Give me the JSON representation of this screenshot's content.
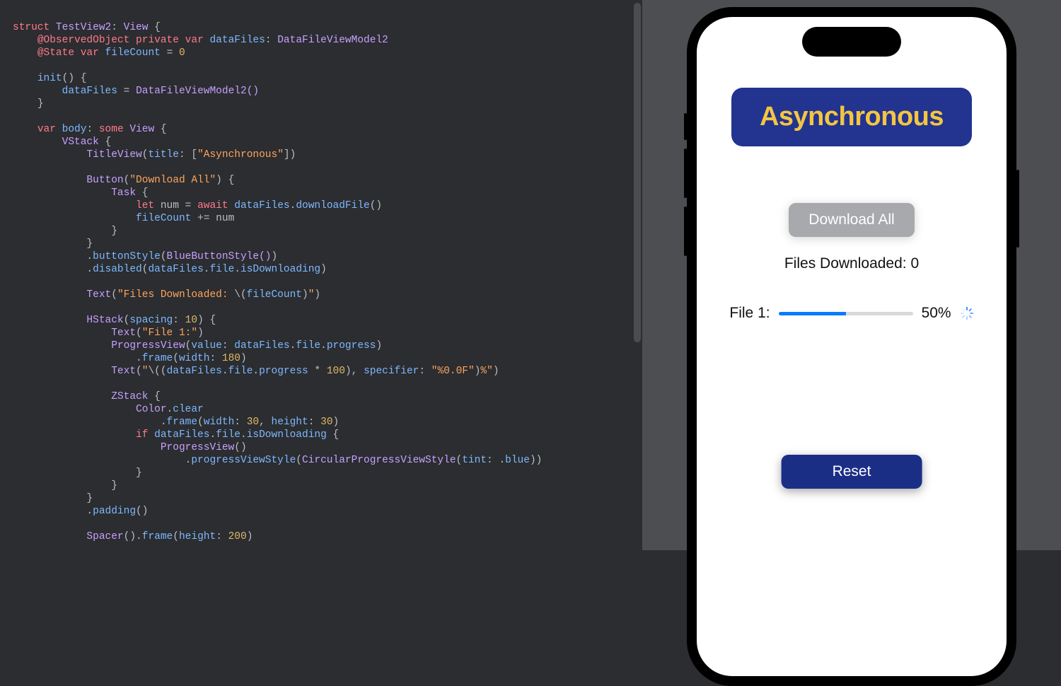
{
  "code": {
    "l1": {
      "kw": "struct",
      "name": "TestView2",
      "colon": ": ",
      "type": "View",
      "brace": " {"
    },
    "l2": {
      "attr": "@ObservedObject",
      "kw1": "private",
      "kw2": "var",
      "name": "dataFiles",
      "colon": ": ",
      "type": "DataFileViewModel2"
    },
    "l3": {
      "attr": "@State",
      "kw": "var",
      "name": "fileCount",
      "eq": " = ",
      "num": "0"
    },
    "l4": "",
    "l5": {
      "name": "init",
      "parens": "() {"
    },
    "l6": {
      "lhs": "dataFiles",
      "eq": " = ",
      "rhs": "DataFileViewModel2()"
    },
    "l7": "}",
    "l8": "",
    "l9": {
      "kw": "var",
      "name": "body",
      "colon": ": ",
      "some": "some",
      "type": "View",
      "brace": " {"
    },
    "l10": {
      "name": "VStack",
      "brace": " {"
    },
    "l11": {
      "name": "TitleView",
      "open": "(",
      "key": "title",
      "colon": ": [",
      "str": "\"Asynchronous\"",
      "close": "])"
    },
    "l12": "",
    "l13": {
      "name": "Button",
      "open": "(",
      "str": "\"Download All\"",
      "close": ") {"
    },
    "l14": {
      "name": "Task",
      "brace": " {"
    },
    "l15": {
      "kw1": "let",
      "name": "num",
      "eq": " = ",
      "kw2": "await",
      "call": "dataFiles",
      "dot": ".",
      "method": "downloadFile",
      "parens": "()"
    },
    "l16": {
      "lhs": "fileCount",
      "op": " += ",
      "rhs": "num"
    },
    "l17": "}",
    "l18": "}",
    "l19": {
      "dot": ".",
      "method": "buttonStyle",
      "open": "(",
      "arg": "BlueButtonStyle()",
      "close": ")"
    },
    "l20": {
      "dot": ".",
      "method": "disabled",
      "open": "(",
      "arg1": "dataFiles",
      "d1": ".",
      "arg2": "file",
      "d2": ".",
      "arg3": "isDownloading",
      "close": ")"
    },
    "l21": "",
    "l22": {
      "name": "Text",
      "open": "(",
      "str1": "\"Files Downloaded: ",
      "interp": "\\(",
      "var": "fileCount",
      "close_interp": ")",
      "str2": "\"",
      "close": ")"
    },
    "l23": "",
    "l24": {
      "name": "HStack",
      "open": "(",
      "key": "spacing",
      "colon": ": ",
      "num": "10",
      "close": ") {"
    },
    "l25": {
      "name": "Text",
      "open": "(",
      "str": "\"File 1:\"",
      "close": ")"
    },
    "l26": {
      "name": "ProgressView",
      "open": "(",
      "key": "value",
      "colon": ": ",
      "arg1": "dataFiles",
      "d1": ".",
      "arg2": "file",
      "d2": ".",
      "arg3": "progress",
      "close": ")"
    },
    "l27": {
      "dot": ".",
      "method": "frame",
      "open": "(",
      "key": "width",
      "colon": ": ",
      "num": "180",
      "close": ")"
    },
    "l28": {
      "name": "Text",
      "open": "(",
      "str1": "\"",
      "interp": "\\((",
      "arg1": "dataFiles",
      "d1": ".",
      "arg2": "file",
      "d2": ".",
      "arg3": "progress",
      "op": " * ",
      "num": "100",
      "close_interp": "), ",
      "key": "specifier",
      "colon": ": ",
      "str2": "\"%0.0F\"",
      "close_interp2": ")",
      "pct": "%",
      "str3": "\"",
      "close": ")"
    },
    "l29": "",
    "l30": {
      "name": "ZStack",
      "brace": " {"
    },
    "l31": {
      "name": "Color",
      "dot": ".",
      "prop": "clear"
    },
    "l32": {
      "dot": ".",
      "method": "frame",
      "open": "(",
      "key1": "width",
      "colon1": ": ",
      "num1": "30",
      "comma": ", ",
      "key2": "height",
      "colon2": ": ",
      "num2": "30",
      "close": ")"
    },
    "l33": {
      "kw": "if",
      "arg1": "dataFiles",
      "d1": ".",
      "arg2": "file",
      "d2": ".",
      "arg3": "isDownloading",
      "brace": " {"
    },
    "l34": {
      "name": "ProgressView",
      "parens": "()"
    },
    "l35": {
      "dot": ".",
      "method": "progressViewStyle",
      "open": "(",
      "type": "CircularProgressViewStyle",
      "open2": "(",
      "key": "tint",
      "colon": ": .",
      "prop": "blue",
      "close": "))"
    },
    "l36": "}",
    "l37": "}",
    "l38": "}",
    "l39": {
      "dot": ".",
      "method": "padding",
      "parens": "()"
    },
    "l40": "",
    "l41": {
      "name": "Spacer",
      "parens": "().",
      "method": "frame",
      "open": "(",
      "key": "height",
      "colon": ": ",
      "num": "200",
      "close": ")"
    }
  },
  "preview": {
    "title": "Asynchronous",
    "download_btn": "Download All",
    "files_label": "Files Downloaded: 0",
    "file_label": "File 1:",
    "progress_percent": 50,
    "progress_text": "50%",
    "reset_btn": "Reset"
  }
}
